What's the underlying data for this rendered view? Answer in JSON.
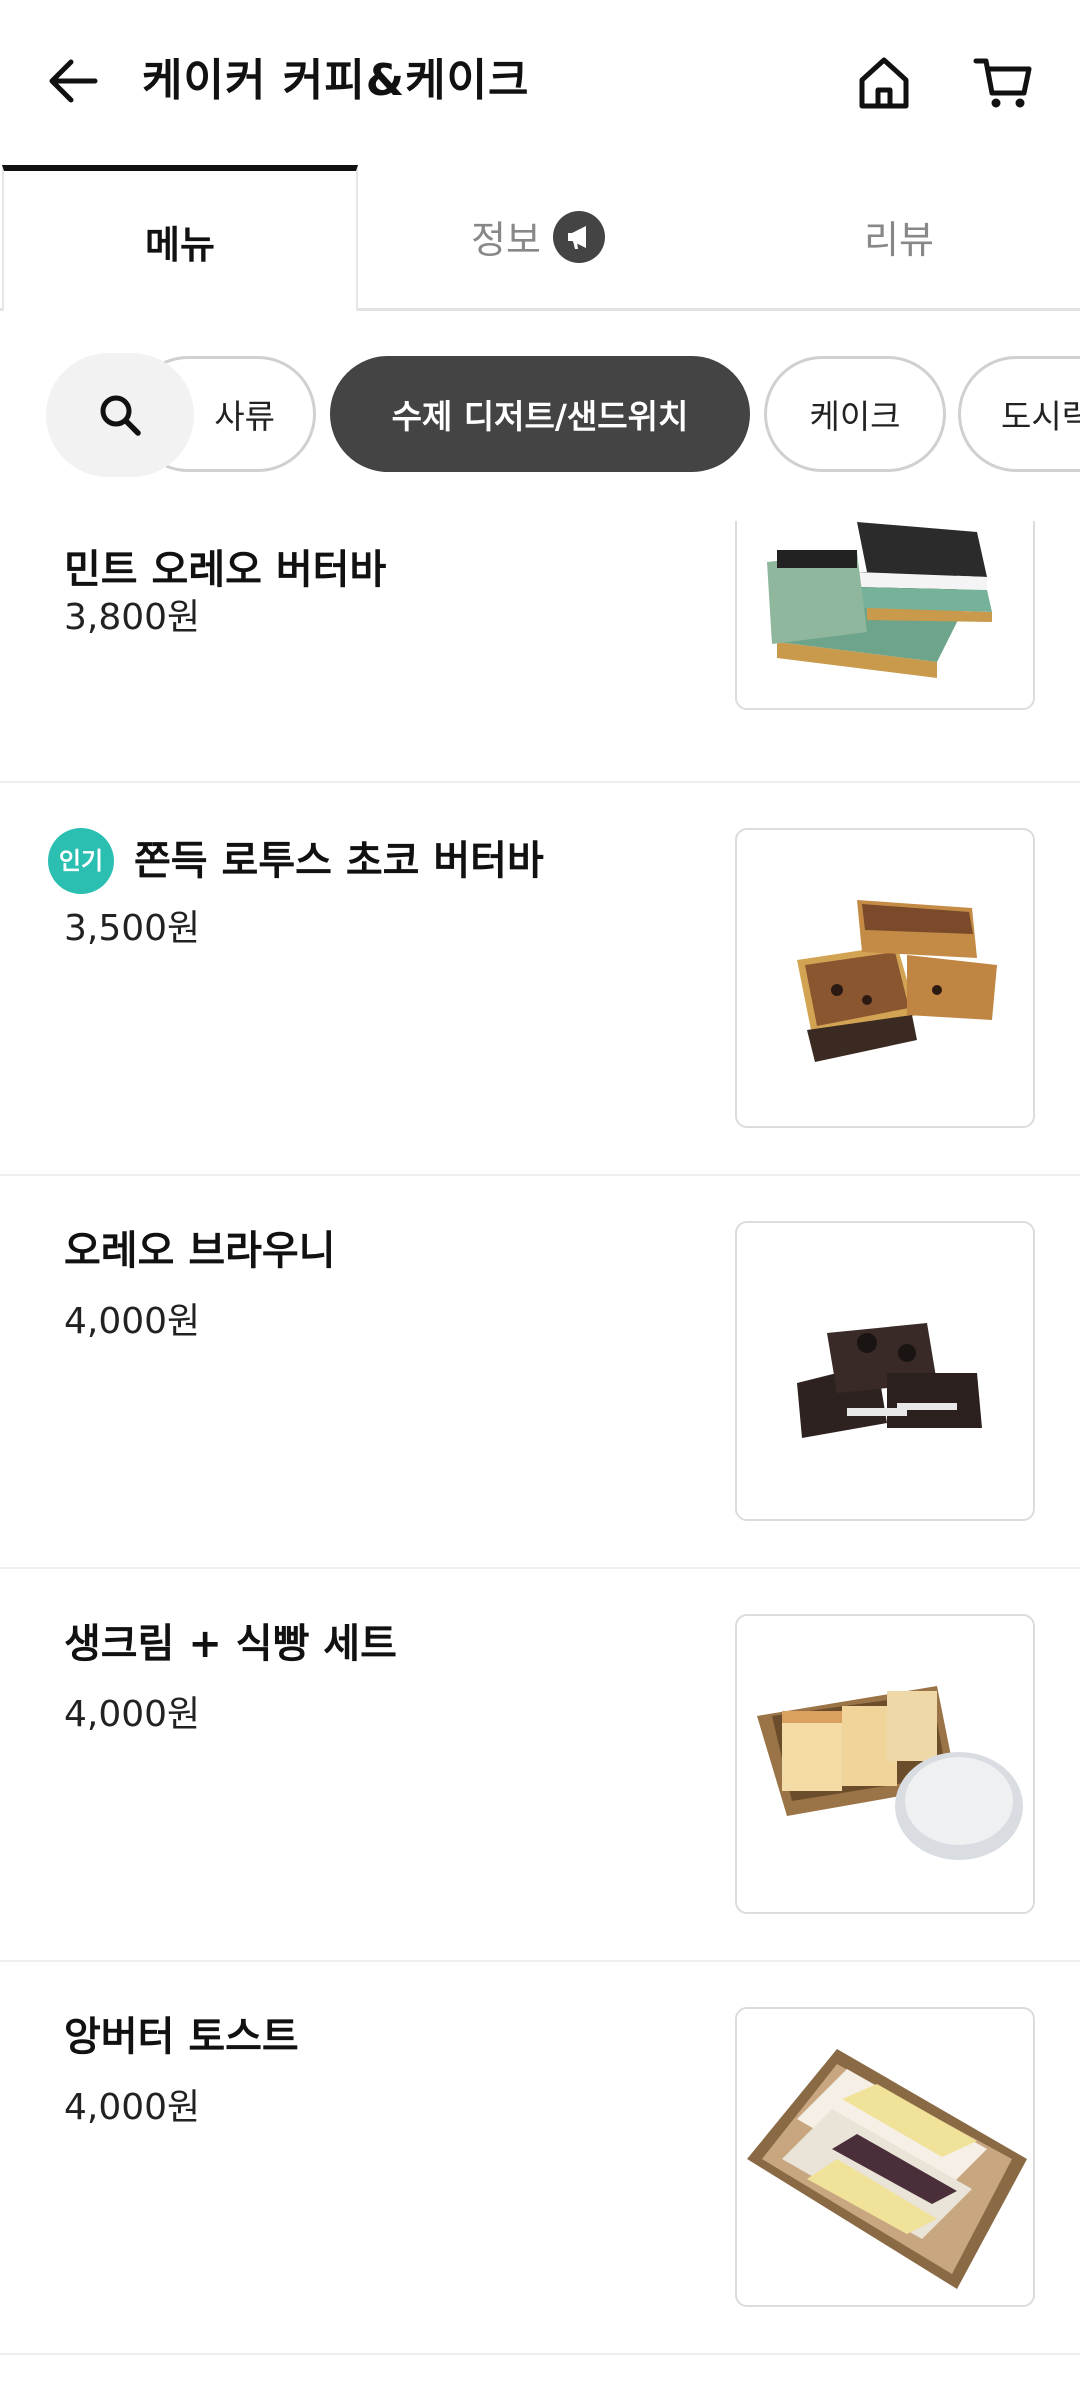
{
  "header": {
    "title": "케이커 커피&케이크",
    "back_icon": "arrow-left-icon",
    "home_icon": "home-icon",
    "cart_icon": "cart-icon"
  },
  "tabs": [
    {
      "label": "메뉴",
      "active": true
    },
    {
      "label": "정보",
      "badge_icon": "megaphone-icon"
    },
    {
      "label": "리뷰"
    }
  ],
  "categories": {
    "search_icon": "search-icon",
    "chips": [
      {
        "label": "사류",
        "active": false
      },
      {
        "label": "수제 디저트/샌드위치",
        "active": true
      },
      {
        "label": "케이크",
        "active": false
      },
      {
        "label": "도시락",
        "active": false
      }
    ]
  },
  "menu": [
    {
      "name": "민트 오레오 버터바",
      "price": "3,800원",
      "popular": false
    },
    {
      "name": "쫀득 로투스 초코 버터바",
      "price": "3,500원",
      "popular": true,
      "badge": "인기"
    },
    {
      "name": "오레오 브라우니",
      "price": "4,000원",
      "popular": false
    },
    {
      "name": "생크림 + 식빵 세트",
      "price": "4,000원",
      "popular": false
    },
    {
      "name": "앙버터 토스트",
      "price": "4,000원",
      "popular": false
    }
  ],
  "colors": {
    "accent_teal": "#2bbfb2",
    "chip_active": "#444444"
  }
}
